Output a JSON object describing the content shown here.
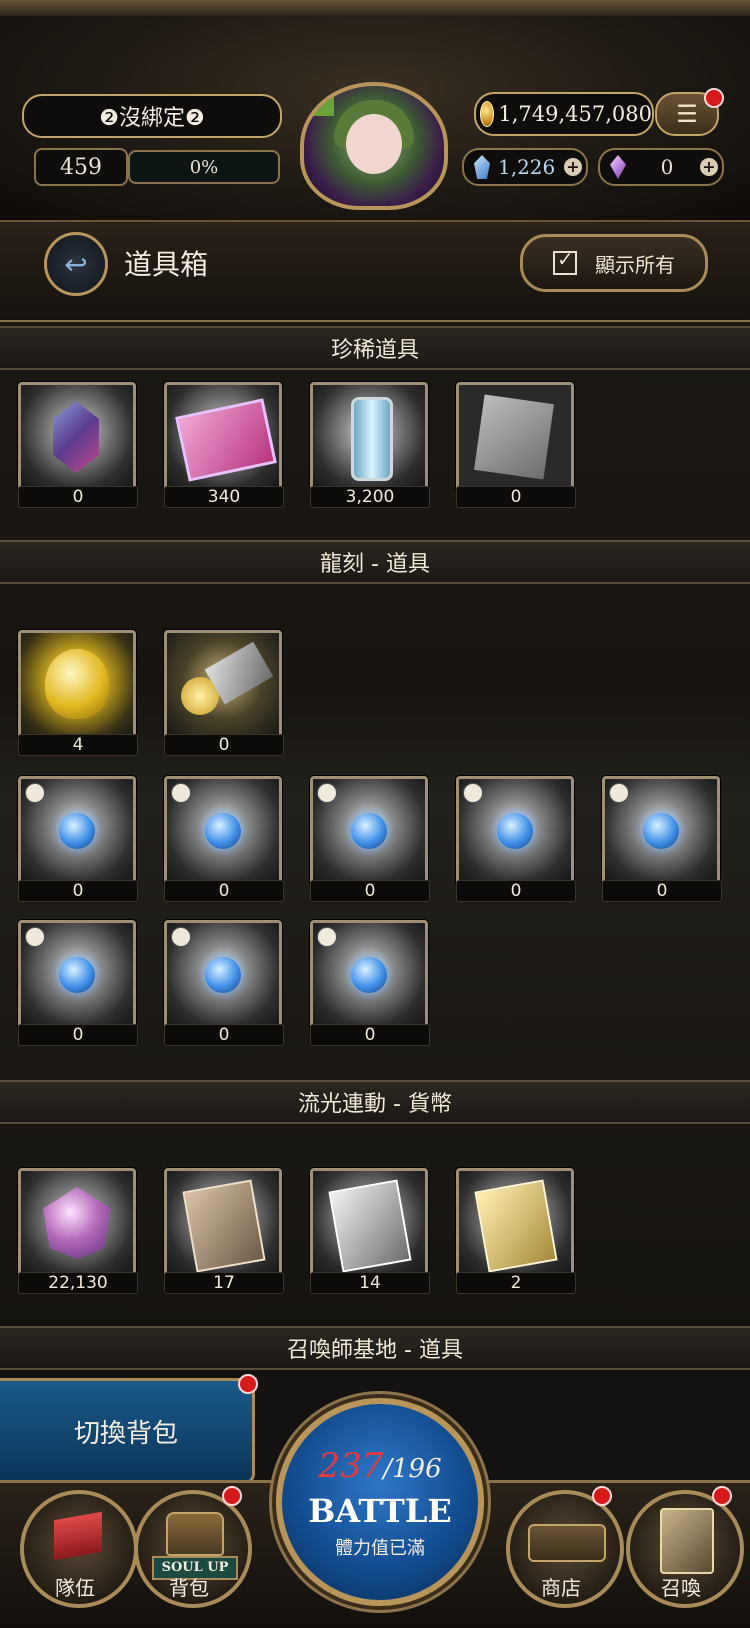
{
  "header": {
    "player_name": "❷沒綁定❷",
    "level": "459",
    "exp_text": "0%",
    "exp_percent": 0,
    "coins": "1,749,457,080",
    "crystals": "1,226",
    "gems": "0"
  },
  "title_bar": {
    "title": "道具箱",
    "show_all_label": "顯示所有"
  },
  "sections": [
    {
      "title": "珍稀道具",
      "items": [
        "0",
        "340",
        "3,200",
        "0"
      ]
    },
    {
      "title": "龍刻 - 道具",
      "items": [
        "4",
        "0",
        "0",
        "0",
        "0",
        "0",
        "0",
        "0",
        "0",
        "0"
      ]
    },
    {
      "title": "流光連動 - 貨幣",
      "items": [
        "22,130",
        "17",
        "14",
        "2"
      ]
    },
    {
      "title": "召喚師基地 - 道具",
      "items": []
    }
  ],
  "bottom": {
    "switch_bag": "切換背包",
    "stamina_current": "237",
    "stamina_max": "/196",
    "battle": "BATTLE",
    "battle_sub": "體力值已滿",
    "soul_up": "SOUL UP",
    "nav": {
      "team": "隊伍",
      "bag": "背包",
      "shop": "商店",
      "summon": "召喚"
    }
  },
  "colors": {
    "accent_gold": "#b8965a",
    "stamina_over": "#e63a3a",
    "battle_blue": "#114a8c"
  }
}
